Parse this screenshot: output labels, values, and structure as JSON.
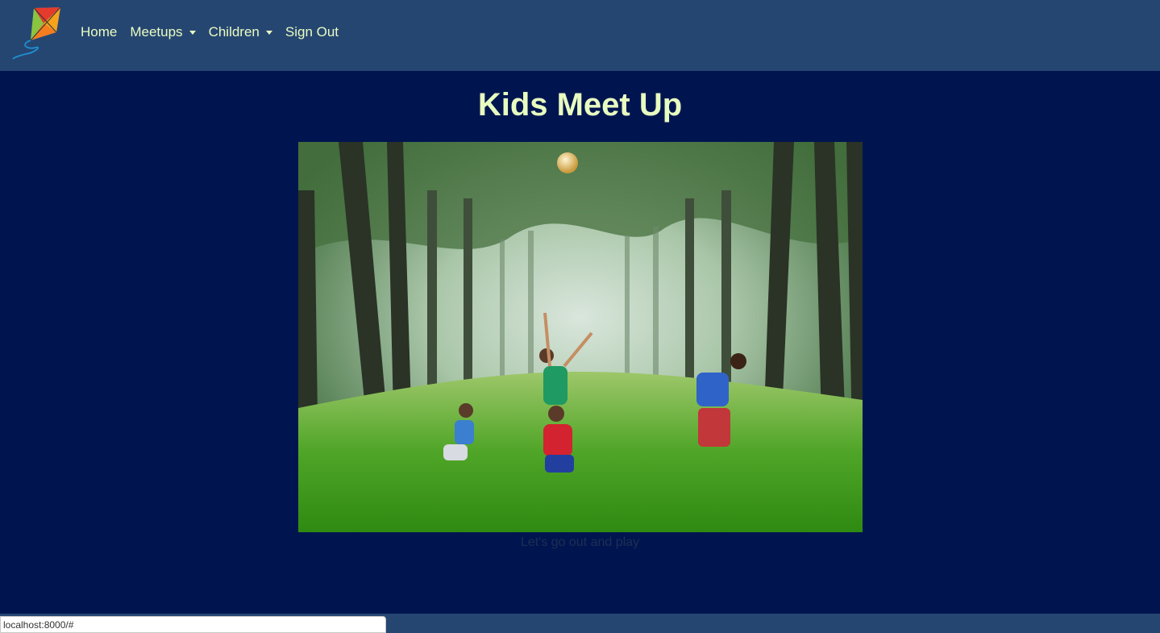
{
  "nav": {
    "logo_icon": "kite-icon",
    "home": "Home",
    "meetups": "Meetups",
    "children": "Children",
    "sign_out": "Sign Out"
  },
  "main": {
    "title": "Kids Meet Up",
    "hero_image": "children-playing-ball-in-forest",
    "caption": "Let's go out and play"
  },
  "status_bar": {
    "url": "localhost:8000/#"
  },
  "colors": {
    "navbar": "#264672",
    "page_background": "#001550",
    "nav_text": "#e9fcc0",
    "title_text": "#e9fcc0"
  }
}
